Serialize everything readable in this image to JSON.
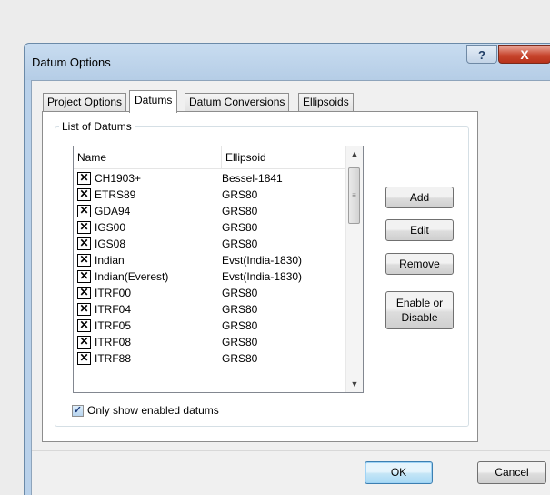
{
  "window": {
    "title": "Datum Options",
    "help_label": "?",
    "close_label": "X"
  },
  "tabs": [
    {
      "label": "Project Options",
      "active": false
    },
    {
      "label": "Datums",
      "active": true
    },
    {
      "label": "Datum Conversions",
      "active": false
    },
    {
      "label": "Ellipsoids",
      "active": false
    }
  ],
  "group": {
    "legend": "List of Datums"
  },
  "list": {
    "columns": [
      "Name",
      "Ellipsoid"
    ],
    "rows": [
      {
        "name": "CH1903+",
        "ellipsoid": "Bessel-1841",
        "checked": true
      },
      {
        "name": "ETRS89",
        "ellipsoid": "GRS80",
        "checked": true
      },
      {
        "name": "GDA94",
        "ellipsoid": "GRS80",
        "checked": true
      },
      {
        "name": "IGS00",
        "ellipsoid": "GRS80",
        "checked": true
      },
      {
        "name": "IGS08",
        "ellipsoid": "GRS80",
        "checked": true
      },
      {
        "name": "Indian",
        "ellipsoid": "Evst(India-1830)",
        "checked": true
      },
      {
        "name": "Indian(Everest)",
        "ellipsoid": "Evst(India-1830)",
        "checked": true
      },
      {
        "name": "ITRF00",
        "ellipsoid": "GRS80",
        "checked": true
      },
      {
        "name": "ITRF04",
        "ellipsoid": "GRS80",
        "checked": true
      },
      {
        "name": "ITRF05",
        "ellipsoid": "GRS80",
        "checked": true
      },
      {
        "name": "ITRF08",
        "ellipsoid": "GRS80",
        "checked": true
      },
      {
        "name": "ITRF88",
        "ellipsoid": "GRS80",
        "checked": true
      }
    ],
    "check_glyph": "✕"
  },
  "side_buttons": {
    "add": "Add",
    "edit": "Edit",
    "remove": "Remove",
    "enable_line1": "Enable or",
    "enable_line2": "Disable"
  },
  "only_enabled": {
    "label": "Only show enabled datums",
    "checked": true,
    "glyph": "✓"
  },
  "footer": {
    "ok": "OK",
    "cancel": "Cancel"
  }
}
